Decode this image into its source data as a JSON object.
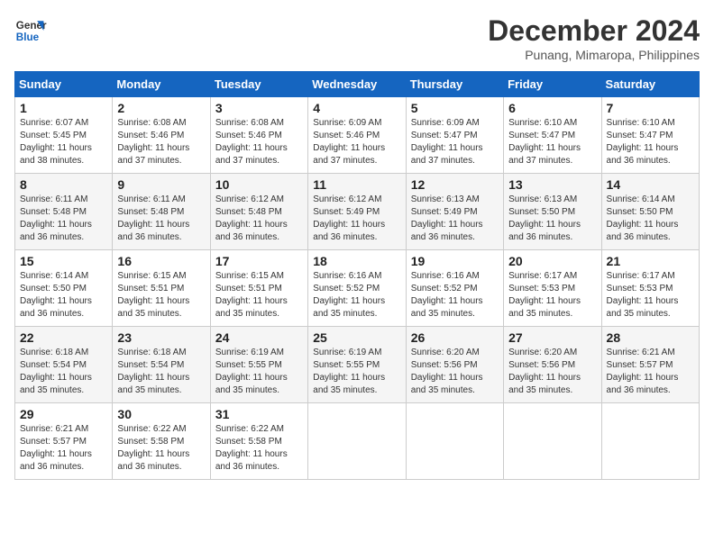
{
  "header": {
    "logo_line1": "General",
    "logo_line2": "Blue",
    "title": "December 2024",
    "subtitle": "Punang, Mimaropa, Philippines"
  },
  "calendar": {
    "days_of_week": [
      "Sunday",
      "Monday",
      "Tuesday",
      "Wednesday",
      "Thursday",
      "Friday",
      "Saturday"
    ],
    "weeks": [
      [
        {
          "day": "1",
          "info": "Sunrise: 6:07 AM\nSunset: 5:45 PM\nDaylight: 11 hours\nand 38 minutes."
        },
        {
          "day": "2",
          "info": "Sunrise: 6:08 AM\nSunset: 5:46 PM\nDaylight: 11 hours\nand 37 minutes."
        },
        {
          "day": "3",
          "info": "Sunrise: 6:08 AM\nSunset: 5:46 PM\nDaylight: 11 hours\nand 37 minutes."
        },
        {
          "day": "4",
          "info": "Sunrise: 6:09 AM\nSunset: 5:46 PM\nDaylight: 11 hours\nand 37 minutes."
        },
        {
          "day": "5",
          "info": "Sunrise: 6:09 AM\nSunset: 5:47 PM\nDaylight: 11 hours\nand 37 minutes."
        },
        {
          "day": "6",
          "info": "Sunrise: 6:10 AM\nSunset: 5:47 PM\nDaylight: 11 hours\nand 37 minutes."
        },
        {
          "day": "7",
          "info": "Sunrise: 6:10 AM\nSunset: 5:47 PM\nDaylight: 11 hours\nand 36 minutes."
        }
      ],
      [
        {
          "day": "8",
          "info": "Sunrise: 6:11 AM\nSunset: 5:48 PM\nDaylight: 11 hours\nand 36 minutes."
        },
        {
          "day": "9",
          "info": "Sunrise: 6:11 AM\nSunset: 5:48 PM\nDaylight: 11 hours\nand 36 minutes."
        },
        {
          "day": "10",
          "info": "Sunrise: 6:12 AM\nSunset: 5:48 PM\nDaylight: 11 hours\nand 36 minutes."
        },
        {
          "day": "11",
          "info": "Sunrise: 6:12 AM\nSunset: 5:49 PM\nDaylight: 11 hours\nand 36 minutes."
        },
        {
          "day": "12",
          "info": "Sunrise: 6:13 AM\nSunset: 5:49 PM\nDaylight: 11 hours\nand 36 minutes."
        },
        {
          "day": "13",
          "info": "Sunrise: 6:13 AM\nSunset: 5:50 PM\nDaylight: 11 hours\nand 36 minutes."
        },
        {
          "day": "14",
          "info": "Sunrise: 6:14 AM\nSunset: 5:50 PM\nDaylight: 11 hours\nand 36 minutes."
        }
      ],
      [
        {
          "day": "15",
          "info": "Sunrise: 6:14 AM\nSunset: 5:50 PM\nDaylight: 11 hours\nand 36 minutes."
        },
        {
          "day": "16",
          "info": "Sunrise: 6:15 AM\nSunset: 5:51 PM\nDaylight: 11 hours\nand 35 minutes."
        },
        {
          "day": "17",
          "info": "Sunrise: 6:15 AM\nSunset: 5:51 PM\nDaylight: 11 hours\nand 35 minutes."
        },
        {
          "day": "18",
          "info": "Sunrise: 6:16 AM\nSunset: 5:52 PM\nDaylight: 11 hours\nand 35 minutes."
        },
        {
          "day": "19",
          "info": "Sunrise: 6:16 AM\nSunset: 5:52 PM\nDaylight: 11 hours\nand 35 minutes."
        },
        {
          "day": "20",
          "info": "Sunrise: 6:17 AM\nSunset: 5:53 PM\nDaylight: 11 hours\nand 35 minutes."
        },
        {
          "day": "21",
          "info": "Sunrise: 6:17 AM\nSunset: 5:53 PM\nDaylight: 11 hours\nand 35 minutes."
        }
      ],
      [
        {
          "day": "22",
          "info": "Sunrise: 6:18 AM\nSunset: 5:54 PM\nDaylight: 11 hours\nand 35 minutes."
        },
        {
          "day": "23",
          "info": "Sunrise: 6:18 AM\nSunset: 5:54 PM\nDaylight: 11 hours\nand 35 minutes."
        },
        {
          "day": "24",
          "info": "Sunrise: 6:19 AM\nSunset: 5:55 PM\nDaylight: 11 hours\nand 35 minutes."
        },
        {
          "day": "25",
          "info": "Sunrise: 6:19 AM\nSunset: 5:55 PM\nDaylight: 11 hours\nand 35 minutes."
        },
        {
          "day": "26",
          "info": "Sunrise: 6:20 AM\nSunset: 5:56 PM\nDaylight: 11 hours\nand 35 minutes."
        },
        {
          "day": "27",
          "info": "Sunrise: 6:20 AM\nSunset: 5:56 PM\nDaylight: 11 hours\nand 35 minutes."
        },
        {
          "day": "28",
          "info": "Sunrise: 6:21 AM\nSunset: 5:57 PM\nDaylight: 11 hours\nand 36 minutes."
        }
      ],
      [
        {
          "day": "29",
          "info": "Sunrise: 6:21 AM\nSunset: 5:57 PM\nDaylight: 11 hours\nand 36 minutes."
        },
        {
          "day": "30",
          "info": "Sunrise: 6:22 AM\nSunset: 5:58 PM\nDaylight: 11 hours\nand 36 minutes."
        },
        {
          "day": "31",
          "info": "Sunrise: 6:22 AM\nSunset: 5:58 PM\nDaylight: 11 hours\nand 36 minutes."
        },
        {
          "day": "",
          "info": ""
        },
        {
          "day": "",
          "info": ""
        },
        {
          "day": "",
          "info": ""
        },
        {
          "day": "",
          "info": ""
        }
      ]
    ]
  }
}
